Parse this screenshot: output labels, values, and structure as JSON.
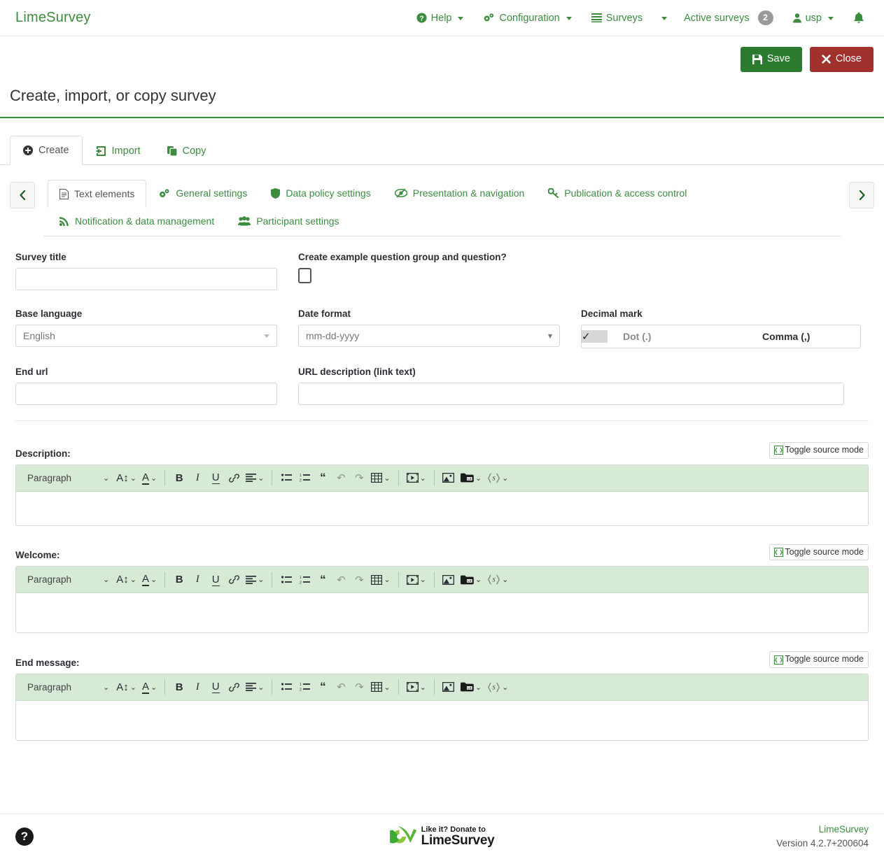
{
  "navbar": {
    "brand": "LimeSurvey",
    "items": [
      {
        "label": "Help",
        "icon": "help-circle-icon",
        "caret": true
      },
      {
        "label": "Configuration",
        "icon": "gears-icon",
        "caret": true
      },
      {
        "label": "Surveys",
        "icon": "list-icon",
        "caret": true
      },
      {
        "label": "Active surveys",
        "icon": "none",
        "badge": "2"
      },
      {
        "label": "usp",
        "icon": "user-icon",
        "caret": true
      }
    ],
    "bell_icon": "bell-icon"
  },
  "actionbar": {
    "save_label": "Save",
    "save_icon": "floppy-disk-icon",
    "close_label": "Close",
    "close_icon": "times-icon"
  },
  "page": {
    "title": "Create, import, or copy survey"
  },
  "outer_tabs": [
    {
      "label": "Create",
      "icon": "plus-circle-icon",
      "active": true
    },
    {
      "label": "Import",
      "icon": "import-arrow-icon",
      "active": false
    },
    {
      "label": "Copy",
      "icon": "copy-icon",
      "active": false
    }
  ],
  "inner_tabs": [
    {
      "label": "Text elements",
      "icon": "file-text-icon",
      "active": true
    },
    {
      "label": "General settings",
      "icon": "gears-icon",
      "active": false
    },
    {
      "label": "Data policy settings",
      "icon": "shield-icon",
      "active": false
    },
    {
      "label": "Presentation & navigation",
      "icon": "eye-slash-icon",
      "active": false
    },
    {
      "label": "Publication & access control",
      "icon": "key-icon",
      "active": false
    },
    {
      "label": "Notification & data management",
      "icon": "rss-icon",
      "active": false
    },
    {
      "label": "Participant settings",
      "icon": "users-icon",
      "active": false
    }
  ],
  "tab_scroll": {
    "prev_icon": "chevron-left-icon",
    "next_icon": "chevron-right-icon"
  },
  "form": {
    "survey_title": {
      "label": "Survey title",
      "value": "",
      "placeholder": ""
    },
    "example_question": {
      "label": "Create example question group and question?",
      "checked": false
    },
    "base_language": {
      "label": "Base language",
      "value": "English"
    },
    "date_format": {
      "label": "Date format",
      "value": "mm-dd-yyyy"
    },
    "decimal_mark": {
      "label": "Decimal mark",
      "options": [
        {
          "label": "Dot (.)",
          "selected": true,
          "check_glyph": "✓"
        },
        {
          "label": "Comma (,)",
          "selected": false,
          "check_glyph": ""
        }
      ]
    },
    "end_url": {
      "label": "End url",
      "value": "",
      "placeholder": ""
    },
    "url_description": {
      "label": "URL description (link text)",
      "value": "",
      "placeholder": ""
    }
  },
  "editors": [
    {
      "label": "Description:",
      "toggle_label": "Toggle source mode",
      "content": ""
    },
    {
      "label": "Welcome:",
      "toggle_label": "Toggle source mode",
      "content": ""
    },
    {
      "label": "End message:",
      "toggle_label": "Toggle source mode",
      "content": ""
    }
  ],
  "toolbar": {
    "paragraph_label": "Paragraph",
    "items": [
      {
        "name": "font-size-icon",
        "glyph": "A↕"
      },
      {
        "name": "font-color-icon",
        "glyph": "A"
      },
      {
        "name": "bold-icon",
        "glyph": "B"
      },
      {
        "name": "italic-icon",
        "glyph": "I"
      },
      {
        "name": "underline-icon",
        "glyph": "U"
      },
      {
        "name": "link-icon",
        "glyph": "🔗"
      },
      {
        "name": "align-icon",
        "glyph": "≡"
      },
      {
        "name": "bullet-list-icon",
        "glyph": "•—"
      },
      {
        "name": "numbered-list-icon",
        "glyph": "1—"
      },
      {
        "name": "blockquote-icon",
        "glyph": "“"
      },
      {
        "name": "undo-icon",
        "glyph": "↩"
      },
      {
        "name": "redo-icon",
        "glyph": "↪"
      },
      {
        "name": "table-icon",
        "glyph": "▦"
      },
      {
        "name": "media-icon",
        "glyph": "▶"
      },
      {
        "name": "image-icon",
        "glyph": "🖼"
      },
      {
        "name": "limesurvey-files-icon",
        "glyph": "LS"
      },
      {
        "name": "expression-icon",
        "glyph": "{LS}"
      }
    ]
  },
  "footer": {
    "help_icon": "question-mark-icon",
    "donate_line1": "Like it? Donate to",
    "donate_line2": "LimeSurvey",
    "donate_logo": "limesurvey-leaf-logo",
    "product_link": "LimeSurvey",
    "version": "Version 4.2.7+200604"
  },
  "colors": {
    "brand_green": "#3c8c40",
    "save_green": "#2b7a2f",
    "close_red": "#a0312c",
    "toolbar_green": "#d6ead6",
    "badge_grey": "#999999"
  }
}
